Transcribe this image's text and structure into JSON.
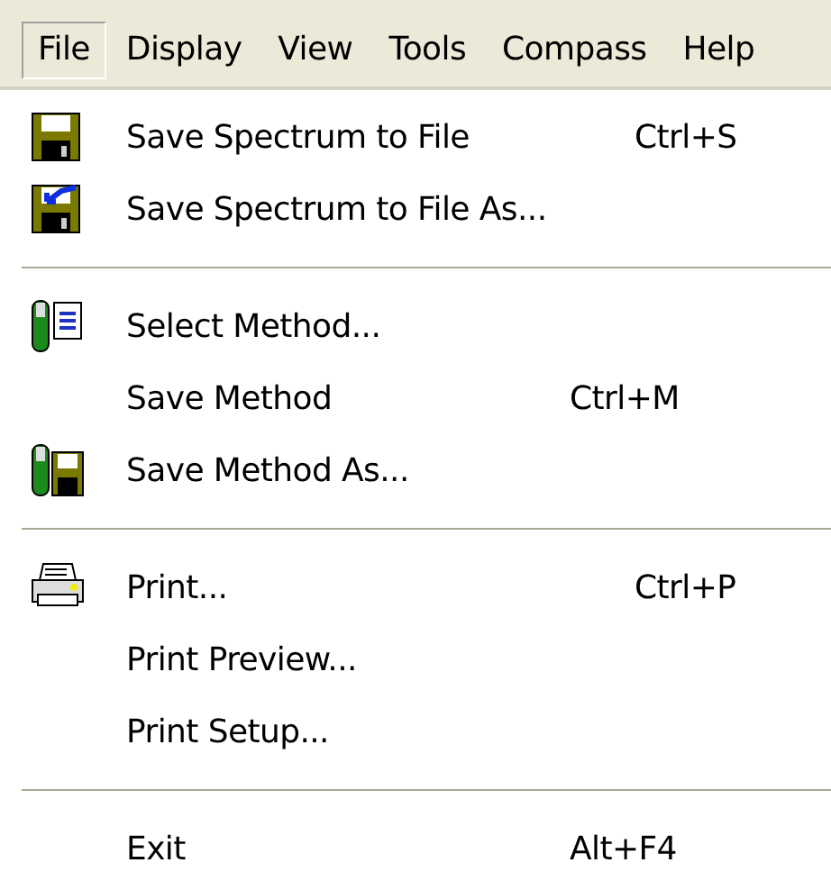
{
  "menu_bar": [
    {
      "label": "File",
      "selected": true
    },
    {
      "label": "Display",
      "selected": false
    },
    {
      "label": "View",
      "selected": false
    },
    {
      "label": "Tools",
      "selected": false
    },
    {
      "label": "Compass",
      "selected": false
    },
    {
      "label": "Help",
      "selected": false
    }
  ],
  "file_menu": [
    {
      "kind": "item",
      "label": "Save Spectrum to File",
      "shortcut": "Ctrl+S"
    },
    {
      "kind": "item",
      "label": "Save Spectrum to File As..."
    },
    {
      "kind": "separator"
    },
    {
      "kind": "item",
      "label": "Select Method..."
    },
    {
      "kind": "item",
      "label": "Save Method",
      "shortcut": "Ctrl+M"
    },
    {
      "kind": "item",
      "label": "Save Method As..."
    },
    {
      "kind": "separator"
    },
    {
      "kind": "item",
      "label": "Print...",
      "shortcut": "Ctrl+P"
    },
    {
      "kind": "item",
      "label": "Print Preview..."
    },
    {
      "kind": "item",
      "label": "Print Setup..."
    },
    {
      "kind": "separator"
    },
    {
      "kind": "item",
      "label": "Exit",
      "shortcut": "Alt+F4"
    }
  ]
}
